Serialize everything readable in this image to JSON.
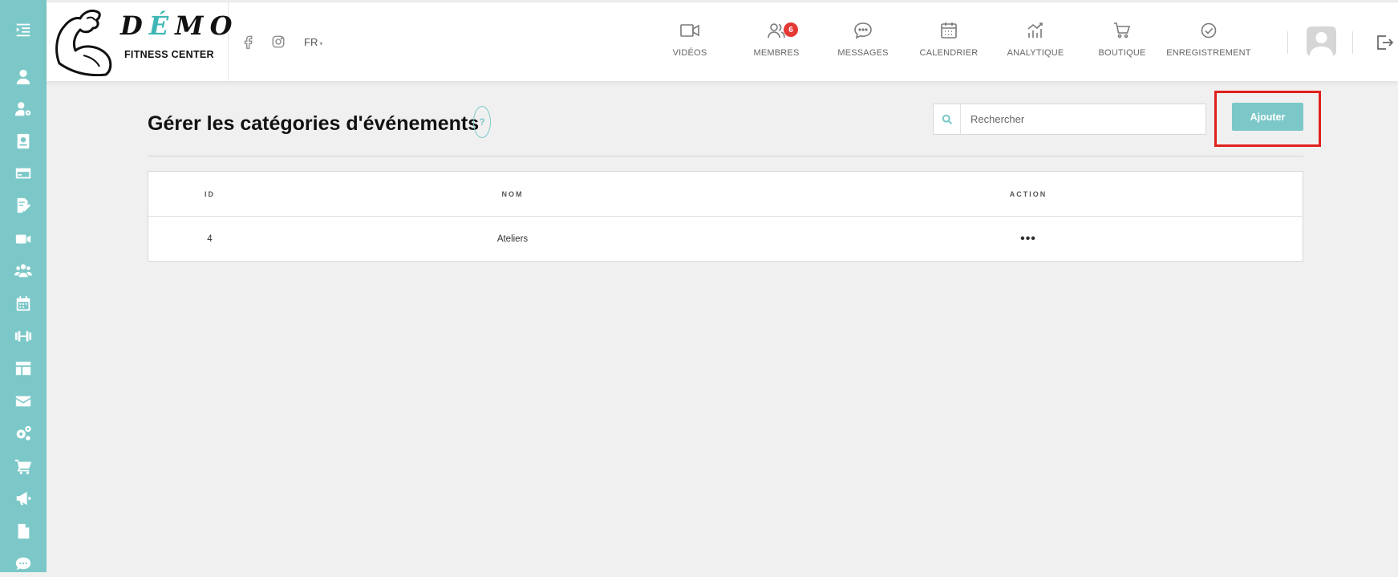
{
  "sidebar": {
    "bg_color": "#7cc8c8",
    "items": [
      {
        "icon": "menu-toggle-icon"
      },
      {
        "icon": "user-icon"
      },
      {
        "icon": "user-cog-icon"
      },
      {
        "icon": "wallet-icon"
      },
      {
        "icon": "credit-card-icon"
      },
      {
        "icon": "file-edit-icon"
      },
      {
        "icon": "video-icon"
      },
      {
        "icon": "users-icon"
      },
      {
        "icon": "calendar-icon"
      },
      {
        "icon": "dumbbell-icon"
      },
      {
        "icon": "layout-icon"
      },
      {
        "icon": "envelope-icon"
      },
      {
        "icon": "cogs-icon"
      },
      {
        "icon": "cart-icon"
      },
      {
        "icon": "megaphone-icon"
      },
      {
        "icon": "file-icon"
      },
      {
        "icon": "chat-icon"
      }
    ]
  },
  "header": {
    "logo": {
      "word_1": "D",
      "word_accent": "É",
      "word_2": "MO",
      "subtitle": "FITNESS CENTER"
    },
    "language": "FR",
    "nav": [
      {
        "label": "VIDÉOS",
        "icon": "video-icon"
      },
      {
        "label": "MEMBRES",
        "icon": "members-icon",
        "badge": "6"
      },
      {
        "label": "MESSAGES",
        "icon": "messages-icon"
      },
      {
        "label": "CALENDRIER",
        "icon": "calendar-icon"
      },
      {
        "label": "ANALYTIQUE",
        "icon": "analytics-icon"
      },
      {
        "label": "BOUTIQUE",
        "icon": "cart-icon"
      },
      {
        "label": "ENREGISTREMENT",
        "icon": "check-circle-icon"
      }
    ]
  },
  "main": {
    "title": "Gérer les catégories d'événements",
    "help_label": "?",
    "search": {
      "placeholder": "Rechercher",
      "value": ""
    },
    "add_button": "Ajouter",
    "table": {
      "headers": [
        "ID",
        "NOM",
        "ACTION"
      ],
      "rows": [
        {
          "id": "4",
          "nom": "Ateliers",
          "action": "•••"
        }
      ]
    }
  },
  "colors": {
    "accent": "#7cc8c8",
    "badge": "#e53935",
    "highlight": "#e0201d"
  }
}
